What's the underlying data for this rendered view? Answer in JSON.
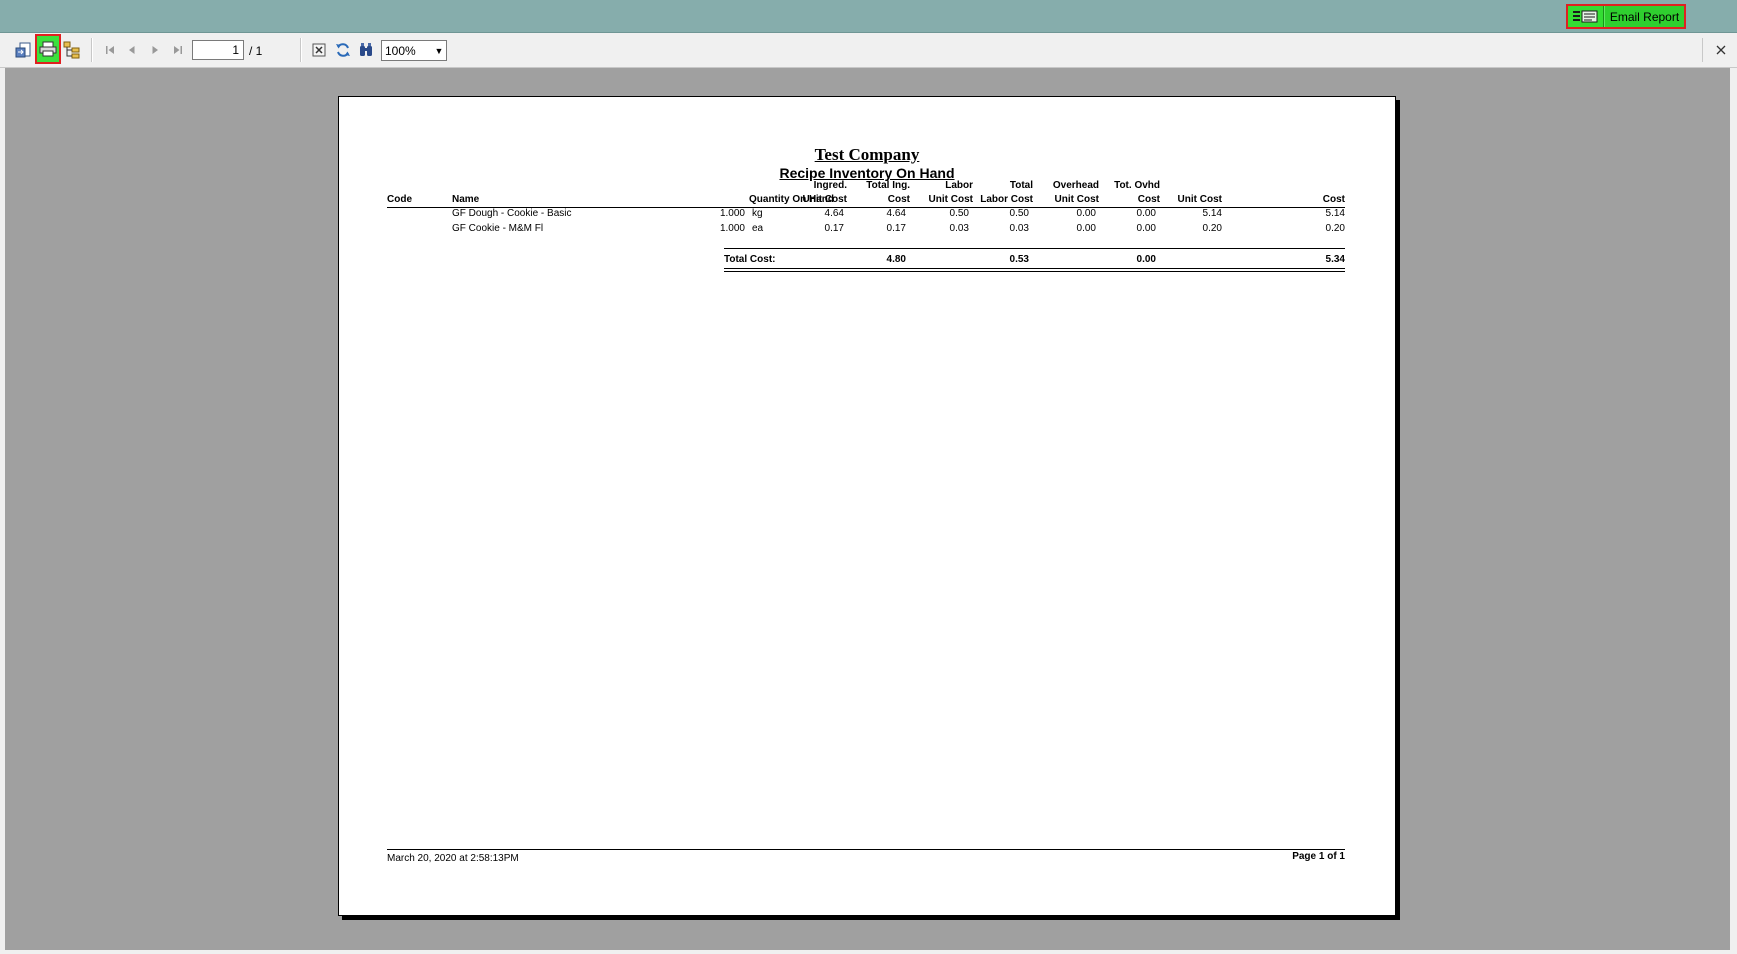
{
  "email": {
    "label": "Email Report"
  },
  "toolbar": {
    "page_current": "1",
    "page_total": "/ 1",
    "zoom": "100%"
  },
  "report": {
    "company": "Test Company",
    "title": "Recipe Inventory On Hand",
    "headers": {
      "code": "Code",
      "name": "Name",
      "qty": "Quantity On Hand",
      "ingred_top": "Ingred.",
      "ingred_bottom": "Unit Cost",
      "totaling_top": "Total Ing.",
      "totaling_bottom": "Cost",
      "labor_top": "Labor",
      "labor_bottom": "Unit Cost",
      "totallabor_top": "Total",
      "totallabor_bottom": "Labor Cost",
      "overhead_top": "Overhead",
      "overhead_bottom": "Unit Cost",
      "totovhd_top": "Tot. Ovhd",
      "totovhd_bottom": "Cost",
      "unitcost": "Unit Cost",
      "cost": "Cost"
    },
    "rows": [
      {
        "code": "",
        "name": "GF Dough - Cookie - Basic",
        "qty": "1.000",
        "unit": "kg",
        "ingred": "4.64",
        "totaling": "4.64",
        "labor": "0.50",
        "totallabor": "0.50",
        "overhead": "0.00",
        "totovhd": "0.00",
        "unitcost": "5.14",
        "cost": "5.14"
      },
      {
        "code": "",
        "name": "GF Cookie - M&M Fl",
        "qty": "1.000",
        "unit": "ea",
        "ingred": "0.17",
        "totaling": "0.17",
        "labor": "0.03",
        "totallabor": "0.03",
        "overhead": "0.00",
        "totovhd": "0.00",
        "unitcost": "0.20",
        "cost": "0.20"
      }
    ],
    "totals": {
      "label": "Total Cost:",
      "totaling": "4.80",
      "totallabor": "0.53",
      "totovhd": "0.00",
      "cost": "5.34"
    },
    "footer": {
      "date": "March 20, 2020 at  2:58:13PM",
      "page": "Page 1 of 1"
    }
  }
}
